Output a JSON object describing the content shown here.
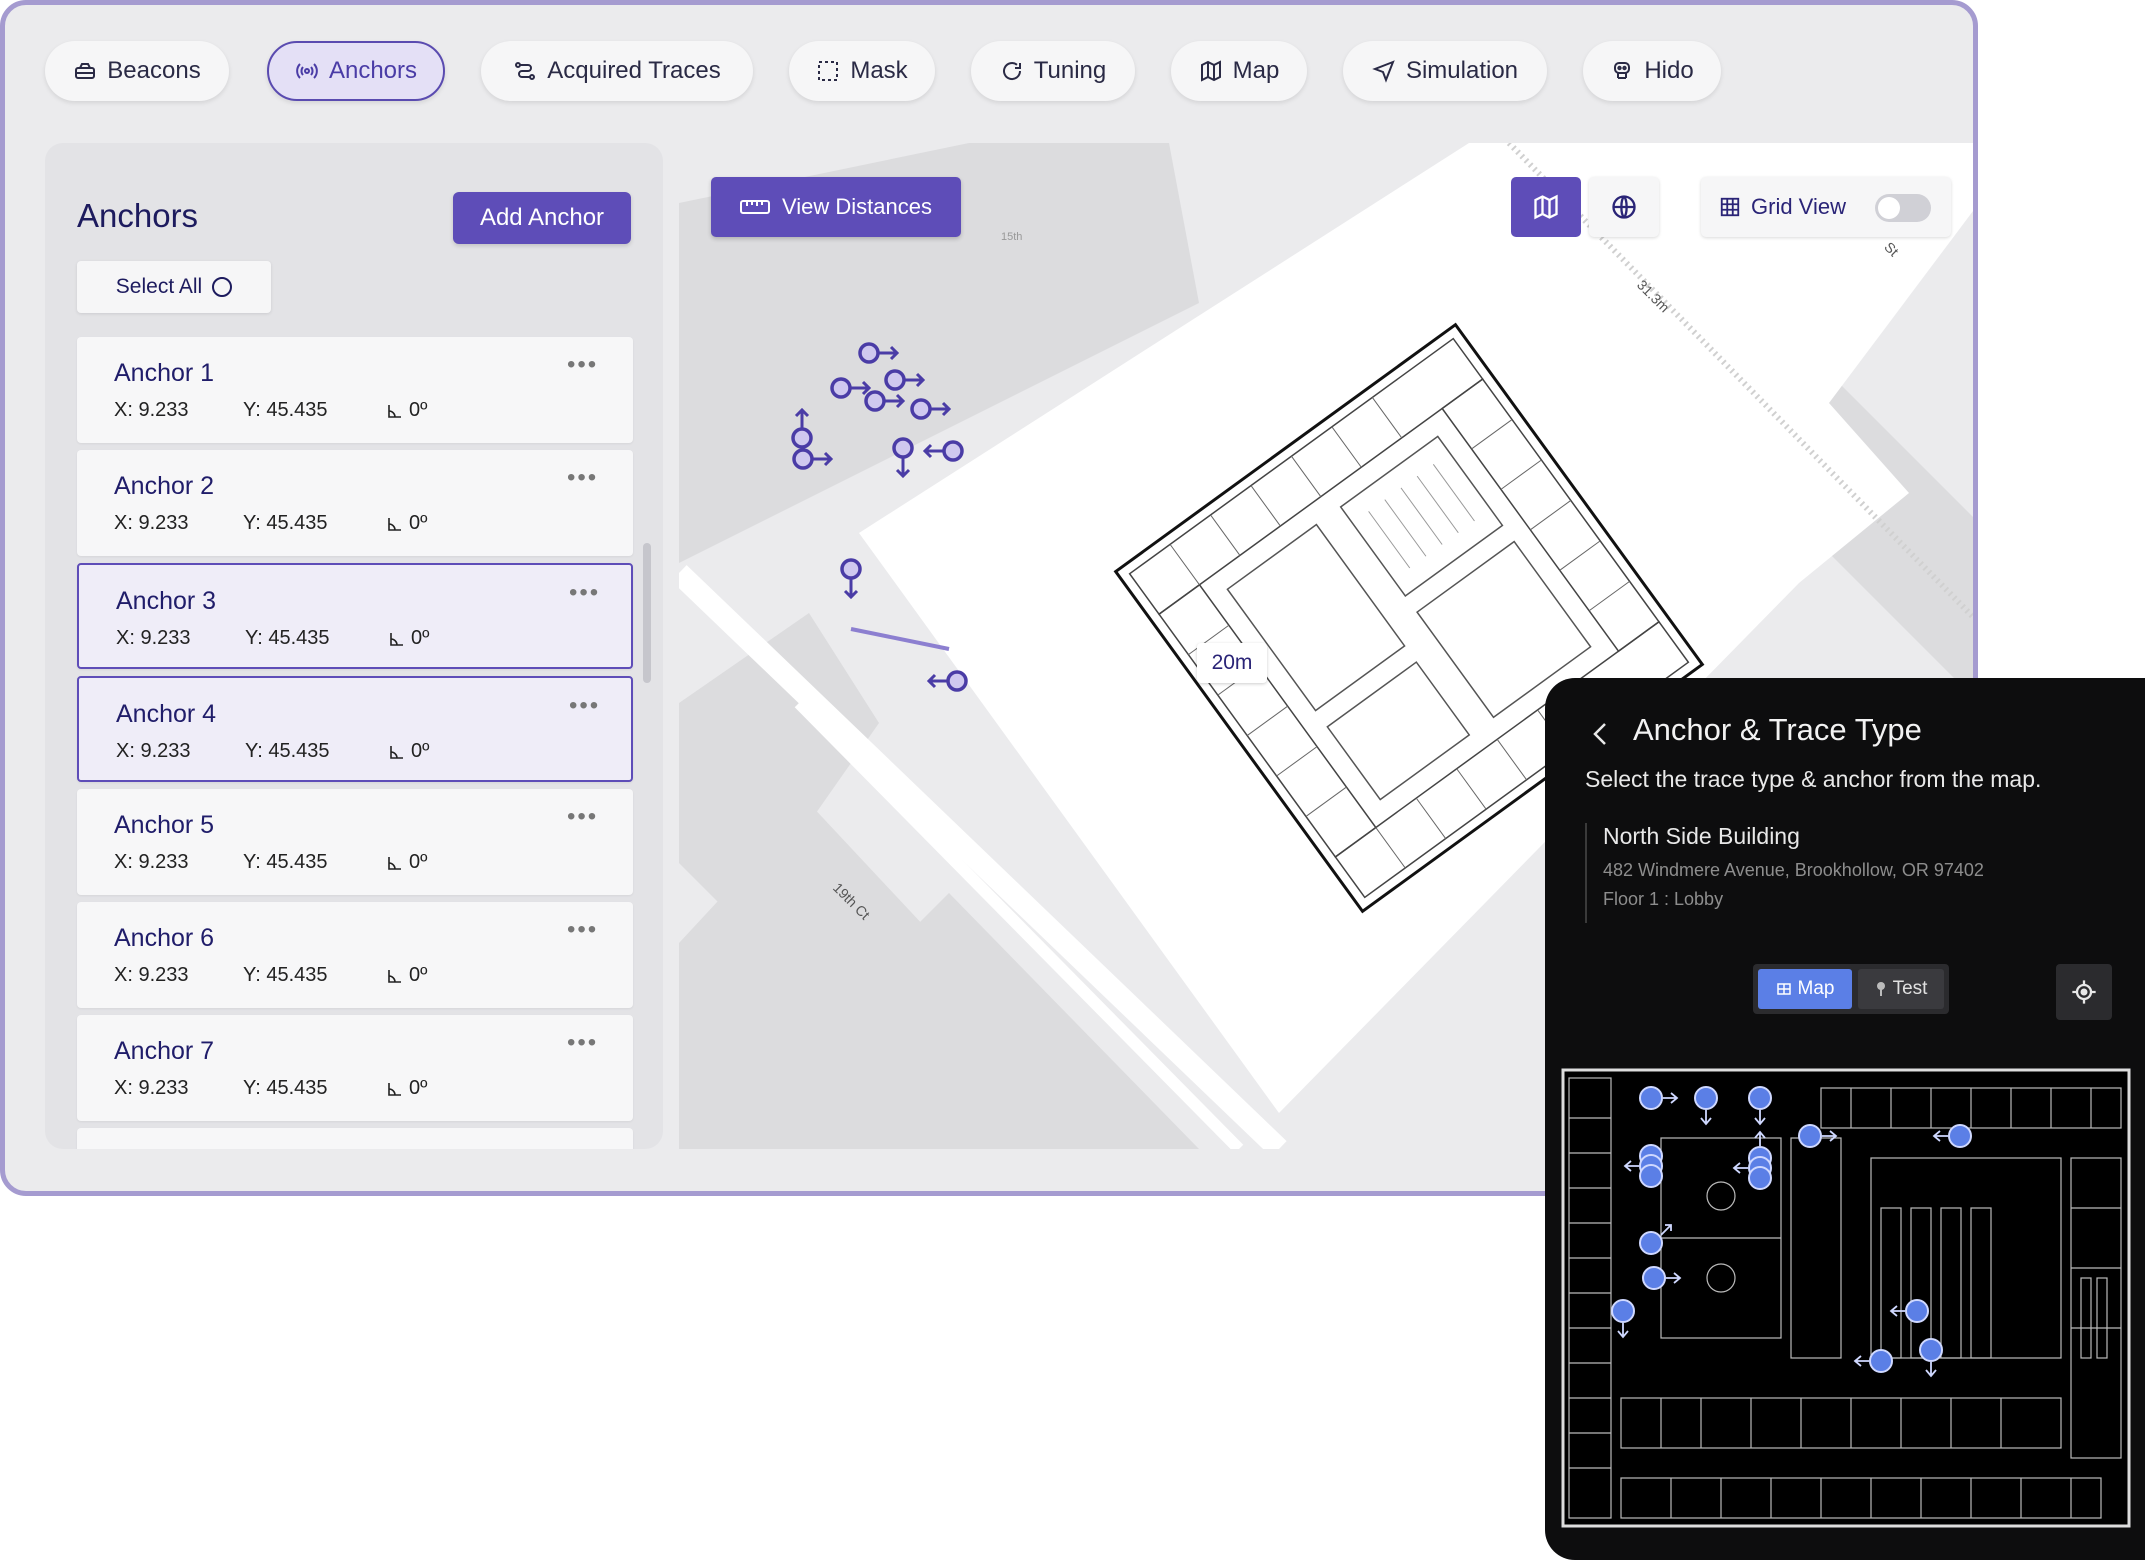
{
  "tabs": [
    {
      "label": "Beacons",
      "icon": "beacon-icon",
      "active": false
    },
    {
      "label": "Anchors",
      "icon": "signal-icon",
      "active": true
    },
    {
      "label": "Acquired Traces",
      "icon": "route-icon",
      "active": false
    },
    {
      "label": "Mask",
      "icon": "mask-icon",
      "active": false
    },
    {
      "label": "Tuning",
      "icon": "refresh-icon",
      "active": false
    },
    {
      "label": "Map",
      "icon": "map-icon",
      "active": false
    },
    {
      "label": "Simulation",
      "icon": "navigation-icon",
      "active": false
    },
    {
      "label": "Hido",
      "icon": "robot-icon",
      "active": false
    }
  ],
  "panel": {
    "title": "Anchors",
    "add_label": "Add Anchor",
    "select_all_label": "Select All",
    "more_label": "•••",
    "anchors": [
      {
        "name": "Anchor 1",
        "x": "X: 9.233",
        "y": "Y: 45.435",
        "angle": "0º",
        "selected": false
      },
      {
        "name": "Anchor 2",
        "x": "X: 9.233",
        "y": "Y: 45.435",
        "angle": "0º",
        "selected": false
      },
      {
        "name": "Anchor 3",
        "x": "X: 9.233",
        "y": "Y: 45.435",
        "angle": "0º",
        "selected": true
      },
      {
        "name": "Anchor 4",
        "x": "X: 9.233",
        "y": "Y: 45.435",
        "angle": "0º",
        "selected": true
      },
      {
        "name": "Anchor 5",
        "x": "X: 9.233",
        "y": "Y: 45.435",
        "angle": "0º",
        "selected": false
      },
      {
        "name": "Anchor 6",
        "x": "X: 9.233",
        "y": "Y: 45.435",
        "angle": "0º",
        "selected": false
      },
      {
        "name": "Anchor 7",
        "x": "X: 9.233",
        "y": "Y: 45.435",
        "angle": "0º",
        "selected": false
      }
    ]
  },
  "map": {
    "view_distances_label": "View Distances",
    "grid_view_label": "Grid View",
    "grid_view_on": false,
    "distance_label": "20m",
    "street_19th": "19th Ct",
    "street_31": "31.3m",
    "street_st": "St",
    "street_15": "15th"
  },
  "overlay": {
    "title": "Anchor & Trace Type",
    "subtitle": "Select the trace type & anchor from the map.",
    "building_name": "North Side Building",
    "address": "482 Windmere Avenue, Brookhollow, OR 97402",
    "floor": "Floor 1 : Lobby",
    "map_label": "Map",
    "test_label": "Test"
  },
  "colors": {
    "accent": "#5e4db8",
    "marker": "#5b7fe6",
    "border": "#a59bd0"
  }
}
